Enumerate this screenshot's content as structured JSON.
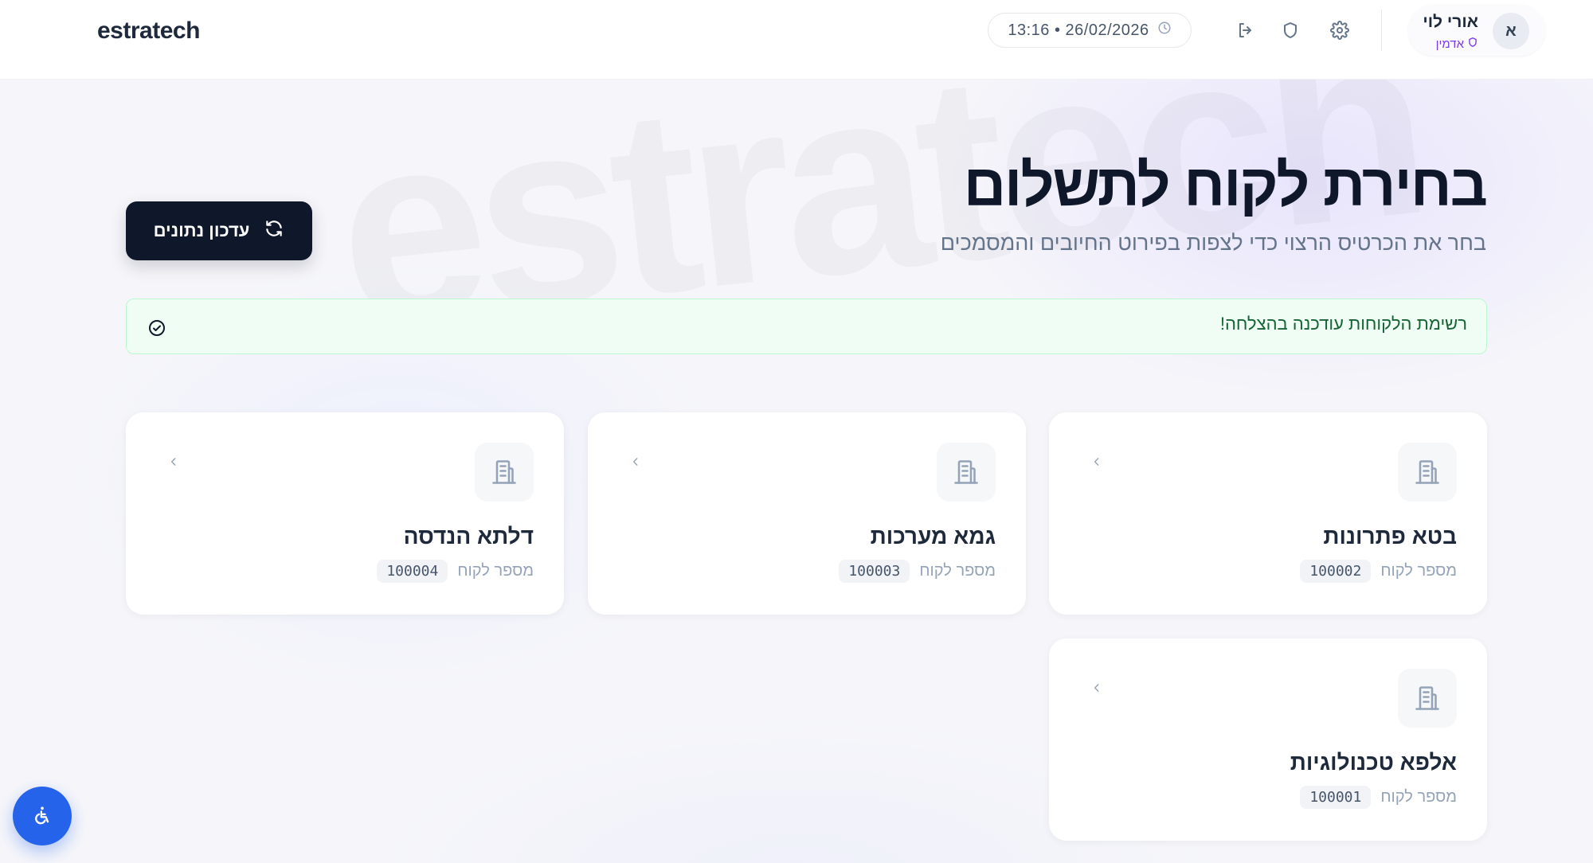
{
  "app": {
    "logo": "estratech",
    "watermark": "estratech"
  },
  "header": {
    "datetime": "13:16 • 26/02/2026",
    "icons": [
      "logout-icon",
      "shield-icon",
      "gear-icon",
      "clock-icon"
    ],
    "user": {
      "name": "אורי לוי",
      "role": "אדמין",
      "avatar_initial": "א"
    }
  },
  "page": {
    "title": "בחירת לקוח לתשלום",
    "subtitle": "בחר את הכרטיס הרצוי כדי לצפות בפירוט החיובים והמסמכים",
    "refresh_label": "עדכון נתונים"
  },
  "alert": {
    "message": "רשימת הלקוחות עודכנה בהצלחה!",
    "type": "success"
  },
  "customers": {
    "id_label": "מספר לקוח",
    "items": [
      {
        "name": "בטא פתרונות",
        "id": "100002"
      },
      {
        "name": "גמא מערכות",
        "id": "100003"
      },
      {
        "name": "דלתא הנדסה",
        "id": "100004"
      },
      {
        "name": "אלפא טכנולוגיות",
        "id": "100001"
      }
    ]
  },
  "colors": {
    "primary": "#0f172a",
    "accent": "#2563eb",
    "success_bg": "#f0fdf4",
    "success_border": "#bbf7d0",
    "success_text": "#166534",
    "role": "#7c3aed"
  }
}
